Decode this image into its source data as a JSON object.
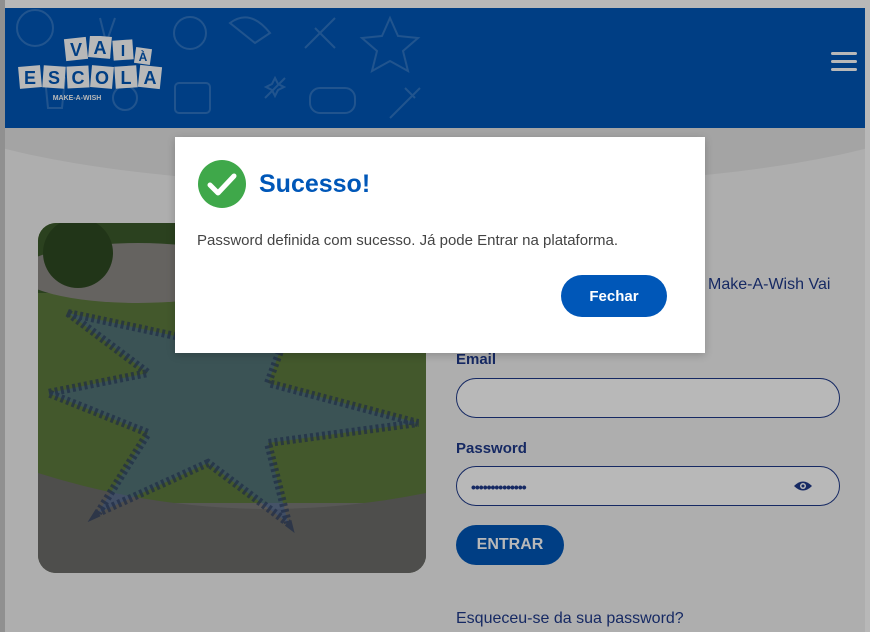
{
  "header": {
    "logo_text_top": "VAI",
    "logo_text_a": "À",
    "logo_text_bottom": "ESCOLA",
    "logo_subtitle": "MAKE-A-WISH",
    "brand_color": "#0057b8"
  },
  "main": {
    "intro_text_fragment": "Make-A-Wish Vai",
    "email_label": "Email",
    "email_value": "",
    "password_label": "Password",
    "password_value": "••••••••••••••",
    "submit_label": "ENTRAR",
    "forgot_link": "Esqueceu-se da sua password?"
  },
  "modal": {
    "title": "Sucesso!",
    "message": "Password definida com sucesso. Já pode Entrar na plataforma.",
    "close_label": "Fechar",
    "success_color": "#3fa84a"
  },
  "icons": {
    "menu": "hamburger-menu-icon",
    "eye": "eye-icon",
    "check": "check-circle-icon"
  }
}
